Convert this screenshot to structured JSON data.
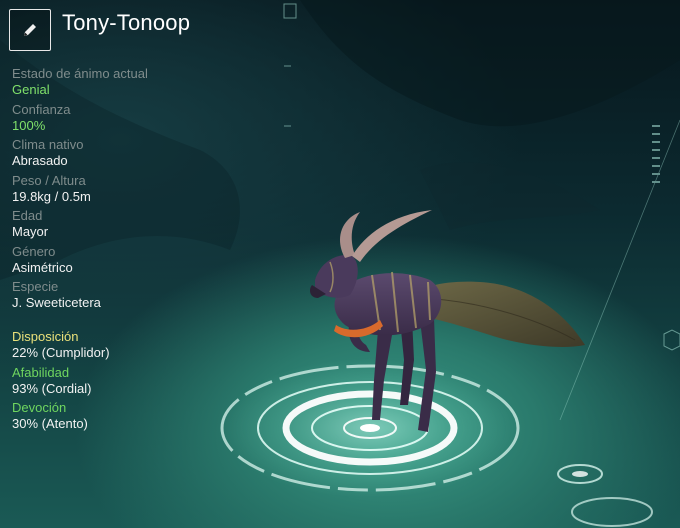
{
  "pet": {
    "name": "Tony-Tonoop"
  },
  "icons": {
    "edit": "pencil-icon"
  },
  "stats": [
    {
      "label": "Estado de ánimo actual",
      "value": "Genial",
      "highlight": true
    },
    {
      "label": "Confianza",
      "value": "100%",
      "highlight": true
    },
    {
      "label": "Clima nativo",
      "value": "Abrasado",
      "highlight": false
    },
    {
      "label": "Peso / Altura",
      "value": "19.8kg / 0.5m",
      "highlight": false
    },
    {
      "label": "Edad",
      "value": "Mayor",
      "highlight": false
    },
    {
      "label": "Género",
      "value": "Asimétrico",
      "highlight": false
    },
    {
      "label": "Especie",
      "value": "J. Sweeticetera",
      "highlight": false
    }
  ],
  "traits": [
    {
      "label": "Disposición",
      "value": "22% (Cumplidor)",
      "color": "#e9e07a"
    },
    {
      "label": "Afabilidad",
      "value": "93% (Cordial)",
      "color": "#6fd65f"
    },
    {
      "label": "Devoción",
      "value": "30% (Atento)",
      "color": "#6fd65f"
    }
  ],
  "colors": {
    "highlight_value": "#7fe06a",
    "label_gray": "#7f8c8c",
    "text_white": "#f2f2f2"
  }
}
